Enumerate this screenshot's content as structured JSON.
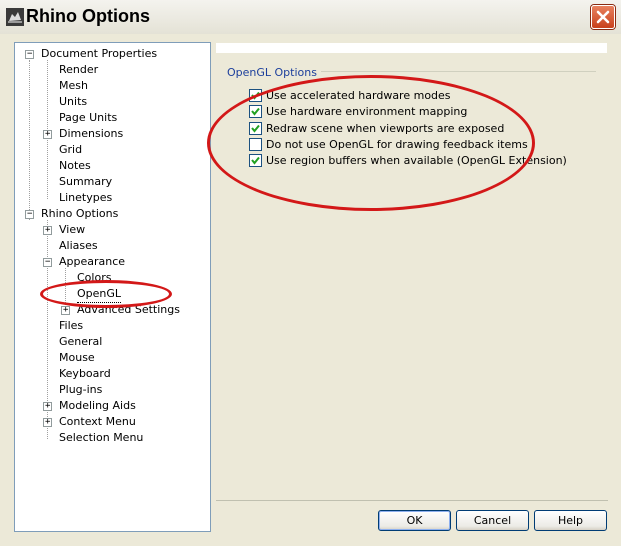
{
  "window": {
    "title": "Rhino Options",
    "close_icon": "close-icon"
  },
  "tree": {
    "items": [
      {
        "label": "Document Properties",
        "expander": "−"
      },
      {
        "label": "Render"
      },
      {
        "label": "Mesh"
      },
      {
        "label": "Units"
      },
      {
        "label": "Page Units"
      },
      {
        "label": "Dimensions",
        "expander": "+"
      },
      {
        "label": "Grid"
      },
      {
        "label": "Notes"
      },
      {
        "label": "Summary"
      },
      {
        "label": "Linetypes"
      },
      {
        "label": "Rhino Options",
        "expander": "−"
      },
      {
        "label": "View",
        "expander": "+"
      },
      {
        "label": "Aliases"
      },
      {
        "label": "Appearance",
        "expander": "−"
      },
      {
        "label": "Colors"
      },
      {
        "label": "OpenGL",
        "selected": true
      },
      {
        "label": "Advanced Settings",
        "expander": "+"
      },
      {
        "label": "Files"
      },
      {
        "label": "General"
      },
      {
        "label": "Mouse"
      },
      {
        "label": "Keyboard"
      },
      {
        "label": "Plug-ins"
      },
      {
        "label": "Modeling Aids",
        "expander": "+"
      },
      {
        "label": "Context Menu",
        "expander": "+"
      },
      {
        "label": "Selection Menu"
      }
    ]
  },
  "opengl": {
    "group_title": "OpenGL Options",
    "options": [
      {
        "label": "Use accelerated hardware modes",
        "checked": true
      },
      {
        "label": "Use hardware environment mapping",
        "checked": true
      },
      {
        "label": "Redraw scene when viewports are exposed",
        "checked": true
      },
      {
        "label": "Do not use OpenGL for drawing feedback items",
        "checked": false
      },
      {
        "label": "Use region buffers when available (OpenGL Extension)",
        "checked": true
      }
    ]
  },
  "buttons": {
    "ok": "OK",
    "cancel": "Cancel",
    "help": "Help"
  },
  "annotation_color": "#d31818"
}
